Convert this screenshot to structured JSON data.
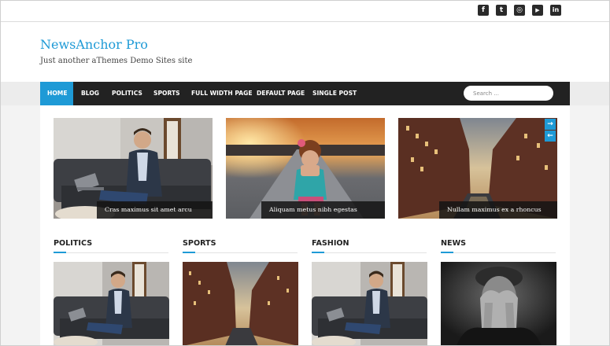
{
  "top_bar": {
    "social_icons": [
      {
        "name": "facebook-icon",
        "glyph": "f"
      },
      {
        "name": "twitter-icon",
        "glyph": "t"
      },
      {
        "name": "instagram-icon",
        "glyph": "◎"
      },
      {
        "name": "youtube-icon",
        "glyph": "▶"
      },
      {
        "name": "linkedin-icon",
        "glyph": "in"
      }
    ]
  },
  "header": {
    "site_title": "NewsAnchor Pro",
    "tagline": "Just another aThemes Demo Sites site"
  },
  "nav": {
    "items": [
      "HOME",
      "BLOG",
      "POLITICS",
      "SPORTS",
      "FULL WIDTH PAGE",
      "DEFAULT PAGE",
      "SINGLE POST"
    ],
    "active": "HOME",
    "search_placeholder": "Search ..."
  },
  "slider": {
    "slides": [
      {
        "caption": "Cras maximus sit amet arcu"
      },
      {
        "caption": "Aliquam metus nibh egestas"
      },
      {
        "caption": "Nullam maximus ex a rhoncus"
      }
    ],
    "next_glyph": "→",
    "prev_glyph": "←"
  },
  "sections": [
    "POLITICS",
    "SPORTS",
    "FASHION",
    "NEWS"
  ],
  "colors": {
    "accent": "#1e9ad6",
    "nav_bg": "#222222",
    "caption_bg": "#141414"
  }
}
